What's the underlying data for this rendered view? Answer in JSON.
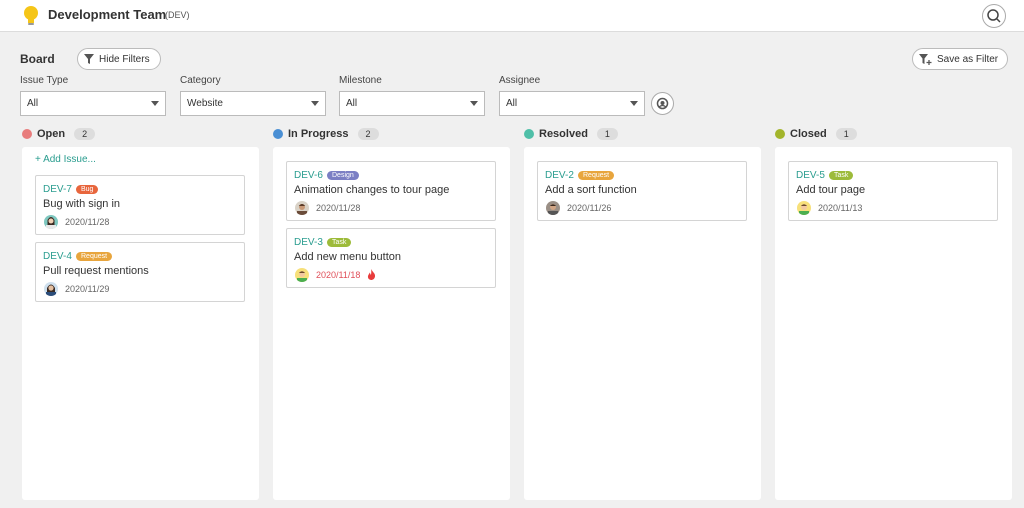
{
  "header": {
    "team_name": "Development Team",
    "team_key": "(DEV)",
    "logo_icon": "lightbulb-icon",
    "search_icon": "search-icon"
  },
  "toolbar": {
    "board_title": "Board",
    "hide_filters_label": "Hide Filters",
    "save_filter_label": "Save as Filter"
  },
  "filters": [
    {
      "label": "Issue Type",
      "value": "All"
    },
    {
      "label": "Category",
      "value": "Website"
    },
    {
      "label": "Milestone",
      "value": "All"
    },
    {
      "label": "Assignee",
      "value": "All"
    }
  ],
  "add_issue_label": "+ Add Issue...",
  "columns": [
    {
      "name": "Open",
      "count": "2",
      "color": "#e87c7c",
      "cards": [
        {
          "key": "DEV-7",
          "badge": "Bug",
          "badge_color": "#e8663d",
          "title": "Bug with sign in",
          "date": "2020/11/28",
          "overdue": false
        },
        {
          "key": "DEV-4",
          "badge": "Request",
          "badge_color": "#e8a53d",
          "title": "Pull request mentions",
          "date": "2020/11/29",
          "overdue": false
        }
      ]
    },
    {
      "name": "In Progress",
      "count": "2",
      "color": "#4a8fd4",
      "cards": [
        {
          "key": "DEV-6",
          "badge": "Design",
          "badge_color": "#7b7fc4",
          "title": "Animation changes to tour page",
          "date": "2020/11/28",
          "overdue": false
        },
        {
          "key": "DEV-3",
          "badge": "Task",
          "badge_color": "#9dbb3a",
          "title": "Add new menu button",
          "date": "2020/11/18",
          "overdue": true
        }
      ]
    },
    {
      "name": "Resolved",
      "count": "1",
      "color": "#4fbfa8",
      "cards": [
        {
          "key": "DEV-2",
          "badge": "Request",
          "badge_color": "#e8a53d",
          "title": "Add a sort function",
          "date": "2020/11/26",
          "overdue": false
        }
      ]
    },
    {
      "name": "Closed",
      "count": "1",
      "color": "#a3b52b",
      "cards": [
        {
          "key": "DEV-5",
          "badge": "Task",
          "badge_color": "#9dbb3a",
          "title": "Add tour page",
          "date": "2020/11/13",
          "overdue": false
        }
      ]
    }
  ]
}
